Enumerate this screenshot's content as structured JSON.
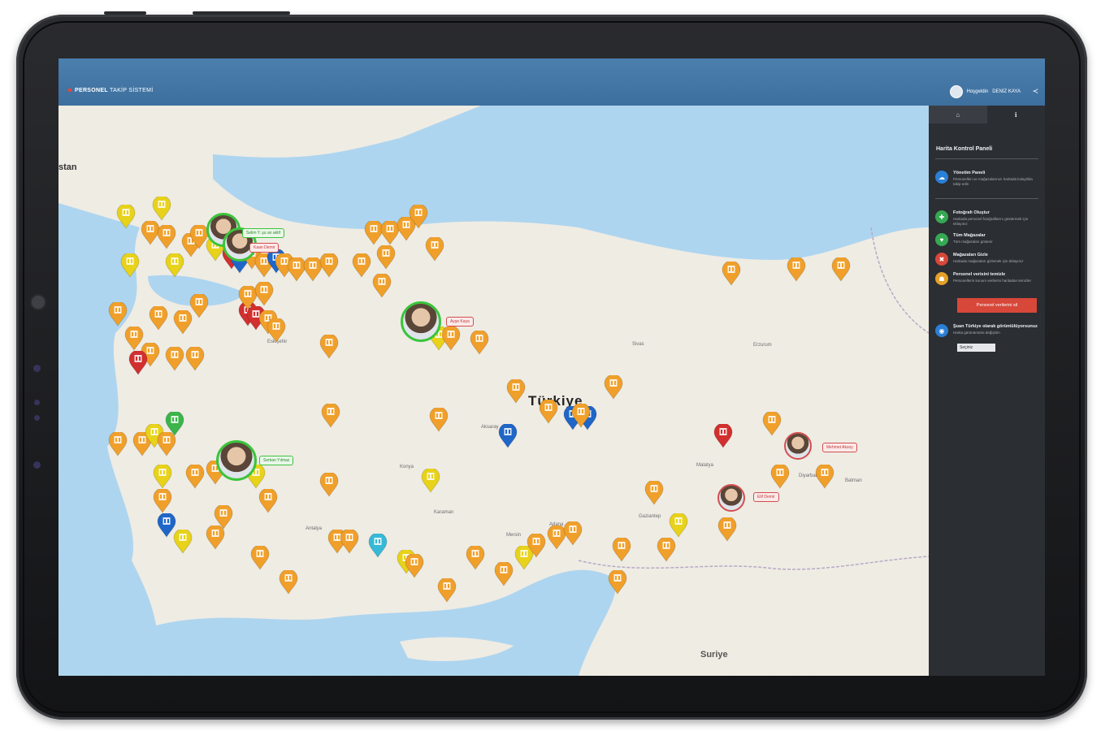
{
  "header": {
    "app_name_bold": "PERSONEL",
    "app_name_rest": "TAKİP SİSTEMİ",
    "greeting": "Hoşgeldin",
    "user_name": "DENİZ KAYA"
  },
  "panel": {
    "tabs": [
      "⌂",
      "ℹ"
    ],
    "title": "Harita Kontrol Paneli",
    "items": [
      {
        "title": "Yönetim Paneli",
        "desc": "Personelleri ve mağazalarınızı haritada kolaylıkla takip edin",
        "color": "#2a7fd6",
        "icon": "☁"
      },
      {
        "title": "Fotoğrafı Oluştur",
        "desc": "Haritada personel fotoğraflarını göstermek için tıklayınız",
        "color": "#35a853",
        "icon": "✚"
      },
      {
        "title": "Tüm Mağazalar",
        "desc": "Tüm mağazaları gösterir",
        "color": "#35a853",
        "icon": "♥"
      },
      {
        "title": "Mağazaları Gizle",
        "desc": "Haritada mağazaları gizlemek için tıklayınız",
        "color": "#d7473a",
        "icon": "✖"
      },
      {
        "title": "Personel verisini temizle",
        "desc": "Personellerin konum verilerini haritadan temizler",
        "color": "#e4a027",
        "icon": "☗"
      }
    ],
    "button": "Personel verilerini sil",
    "footer_title": "Şuan Türkiye olarak görüntülüyorsunuz",
    "footer_desc": "Harita görünümünü değiştirin",
    "select_value": "Seçiniz"
  },
  "map": {
    "country": "Türkiye",
    "labels": {
      "stan": "stan",
      "syria": "Suriye",
      "eskisehir": "Eskişehir",
      "konya": "Konya",
      "antalya": "Antalya",
      "mersin": "Mersin",
      "adana": "Adana",
      "sivas": "Sivas",
      "erzurum": "Erzurum",
      "malatya": "Malatya",
      "karaman": "Karaman",
      "aksaray": "Aksaray",
      "diyarbakir": "Diyarbakır",
      "batman": "Batman",
      "gaziantep": "Gaziantep"
    },
    "tags": [
      {
        "text": "Selim Y. şu an aktif",
        "type": "green"
      },
      {
        "text": "Kaan Demir",
        "type": "red"
      },
      {
        "text": "Ayşe Kaya",
        "type": "red"
      },
      {
        "text": "Serkan Yılmaz",
        "type": "green"
      },
      {
        "text": "Mehmet Aksoy",
        "type": "red"
      },
      {
        "text": "Elif Demir",
        "type": "red"
      }
    ],
    "pin_colors": {
      "orange": "#f0a02a",
      "yellow": "#e8d21a",
      "blue": "#1f66c8",
      "red": "#d22f2f",
      "cyan": "#36b9d6",
      "green": "#3bb54a"
    }
  }
}
